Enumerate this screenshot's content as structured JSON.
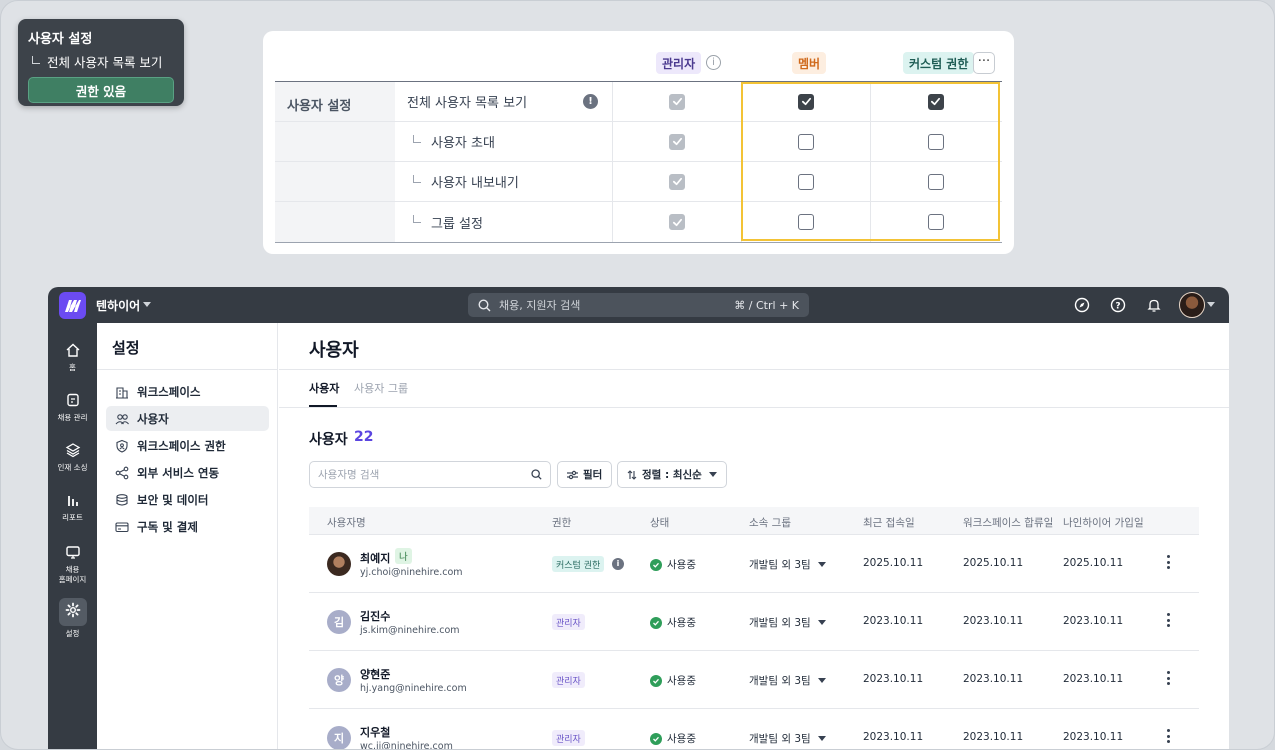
{
  "tooltip": {
    "title": "사용자 설정",
    "sub": "전체 사용자 목록 보기",
    "button": "권한 있음"
  },
  "permission_card": {
    "columns": {
      "admin": "관리자",
      "member": "멤버",
      "custom": "커스텀 권한"
    },
    "category": "사용자 설정",
    "rows": [
      {
        "name": "전체 사용자 목록 보기",
        "indent": false,
        "admin": true,
        "member": true,
        "custom": true
      },
      {
        "name": "사용자 초대",
        "indent": true,
        "admin": true,
        "member": false,
        "custom": false
      },
      {
        "name": "사용자 내보내기",
        "indent": true,
        "admin": true,
        "member": false,
        "custom": false
      },
      {
        "name": "그룹 설정",
        "indent": true,
        "admin": true,
        "member": false,
        "custom": false
      }
    ],
    "highlight_color": "#f3c335"
  },
  "topbar": {
    "workspace": "텐하이어",
    "search_placeholder": "채용, 지원자 검색",
    "shortcut": "⌘ / Ctrl + K"
  },
  "rail": [
    {
      "label": "홈",
      "icon": "home-icon"
    },
    {
      "label": "채용 관리",
      "icon": "note-icon"
    },
    {
      "label": "인재 소싱",
      "icon": "layers-icon"
    },
    {
      "label": "리포트",
      "icon": "bar-chart-icon"
    },
    {
      "label": "채용\n홈페이지",
      "icon": "monitor-icon"
    },
    {
      "label": "설정",
      "icon": "gear-icon",
      "active": true
    }
  ],
  "sidebar": {
    "title": "설정",
    "items": [
      {
        "label": "워크스페이스",
        "icon": "building-icon"
      },
      {
        "label": "사용자",
        "icon": "users-icon",
        "active": true
      },
      {
        "label": "워크스페이스 권한",
        "icon": "shield-icon"
      },
      {
        "label": "외부 서비스 연동",
        "icon": "share-icon"
      },
      {
        "label": "보안 및 데이터",
        "icon": "database-icon"
      },
      {
        "label": "구독 및 결제",
        "icon": "credit-card-icon"
      }
    ]
  },
  "main": {
    "title": "사용자",
    "tabs": [
      {
        "label": "사용자",
        "active": true
      },
      {
        "label": "사용자 그룹",
        "active": false
      }
    ],
    "count_label": "사용자",
    "count": "22",
    "search_placeholder": "사용자명 검색",
    "filter_label": "필터",
    "sort_label": "정렬 : 최신순",
    "accent": "#5b45e0"
  },
  "table": {
    "headers": [
      "사용자명",
      "권한",
      "상태",
      "소속 그룹",
      "최근 접속일",
      "워크스페이스 합류일",
      "나인하이어 가입일"
    ],
    "rows": [
      {
        "initial": "",
        "photo": true,
        "name": "최예지",
        "me": "나",
        "email": "yj.choi@ninehire.com",
        "role": "커스텀 권한",
        "role_type": "custom",
        "status": "사용중",
        "group": "개발팀 외 3팀",
        "last": "2025.10.11",
        "joined": "2025.10.11",
        "signup": "2025.10.11"
      },
      {
        "initial": "김",
        "photo": false,
        "name": "김진수",
        "me": "",
        "email": "js.kim@ninehire.com",
        "role": "관리자",
        "role_type": "admin",
        "status": "사용중",
        "group": "개발팀 외 3팀",
        "last": "2023.10.11",
        "joined": "2023.10.11",
        "signup": "2023.10.11"
      },
      {
        "initial": "양",
        "photo": false,
        "name": "양현준",
        "me": "",
        "email": "hj.yang@ninehire.com",
        "role": "관리자",
        "role_type": "admin",
        "status": "사용중",
        "group": "개발팀 외 3팀",
        "last": "2023.10.11",
        "joined": "2023.10.11",
        "signup": "2023.10.11"
      },
      {
        "initial": "지",
        "photo": false,
        "name": "지우철",
        "me": "",
        "email": "wc.ji@ninehire.com",
        "role": "관리자",
        "role_type": "admin",
        "status": "사용중",
        "group": "개발팀 외 3팀",
        "last": "2023.10.11",
        "joined": "2023.10.11",
        "signup": "2023.10.11"
      }
    ]
  }
}
